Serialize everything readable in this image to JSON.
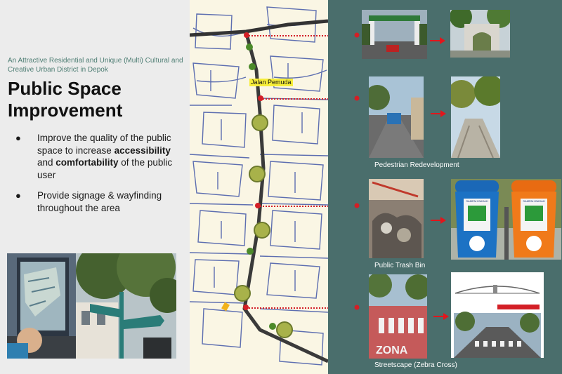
{
  "left_panel": {
    "subtitle": "An Attractive Residential and Unique (Multi) Cultural and Creative Urban District in Depok",
    "title_line1": "Public Space",
    "title_line2": "Improvement",
    "bullet1": {
      "part1": "Improve the quality of the public space to increase ",
      "bold1": "accessibility",
      "part2": " and ",
      "bold2": "comfortability",
      "part3": " of the public user"
    },
    "bullet2": "Provide signage & wayfinding throughout the area",
    "bullet_symbol": "●"
  },
  "map": {
    "route_label": "Jalan Pemuda"
  },
  "right_panel": {
    "caption_pedestrian": "Pedestrian Redevelopment",
    "caption_trash": "Public Trash Bin",
    "caption_streetscape": "Streetscape (Zebra Cross)",
    "trash_bin_label": "SAMPAH BASAH",
    "zona_text": "ZONA"
  },
  "colors": {
    "accent_red": "#d31f26",
    "panel_teal": "#4a6e6c",
    "route_label_bg": "#f7ee3a"
  }
}
